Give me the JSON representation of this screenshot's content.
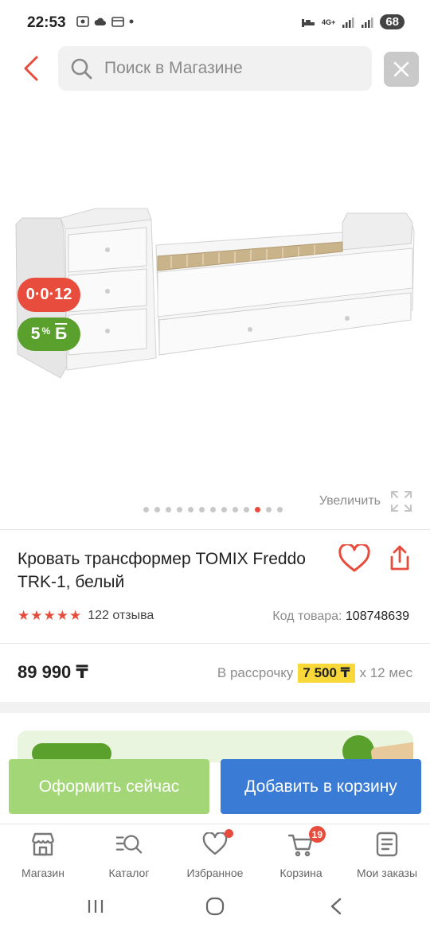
{
  "status": {
    "time": "22:53",
    "battery": "68",
    "network": "4G+"
  },
  "header": {
    "search_placeholder": "Поиск в Магазине"
  },
  "gallery": {
    "credit_badge": "0·0·12",
    "bonus_badge_value": "5",
    "bonus_badge_unit": "%",
    "bonus_badge_symbol": "Б",
    "zoom_label": "Увеличить",
    "dots_total": 13,
    "dots_active_index": 10
  },
  "product": {
    "title": "Кровать трансформер TOMIX Freddo TRK-1, белый",
    "rating_stars": 5,
    "reviews": "122 отзыва",
    "sku_label": "Код товара:",
    "sku_value": "108748639",
    "price": "89 990 ₸",
    "installment_prefix": "В рассрочку",
    "installment_amount": "7 500 ₸",
    "installment_suffix": "х 12 мес"
  },
  "actions": {
    "buy_now": "Оформить сейчас",
    "add_to_cart": "Добавить в корзину"
  },
  "tabs": [
    {
      "label": "Магазин",
      "icon": "store-icon"
    },
    {
      "label": "Каталог",
      "icon": "catalog-search-icon"
    },
    {
      "label": "Избранное",
      "icon": "heart-icon"
    },
    {
      "label": "Корзина",
      "icon": "cart-icon",
      "badge": "19"
    },
    {
      "label": "Мои заказы",
      "icon": "orders-icon"
    }
  ],
  "colors": {
    "accent_red": "#e74c3c",
    "green": "#5aa02c",
    "light_green_button": "#a3d676",
    "blue_button": "#3a7bd5",
    "highlight_yellow": "#f9d83a"
  }
}
